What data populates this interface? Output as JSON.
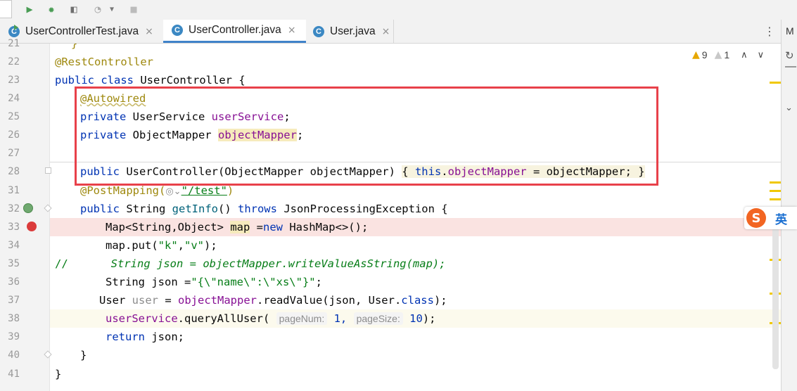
{
  "toolbar": {
    "buttons": [
      "run-icon",
      "debug-icon",
      "coverage-icon",
      "profiler-icon",
      "dropdown-icon",
      "stop-icon"
    ]
  },
  "tabs": [
    {
      "label": "UserControllerTest.java",
      "close": "×",
      "active": false
    },
    {
      "label": "UserController.java",
      "close": "×",
      "active": true
    },
    {
      "label": "User.java",
      "close": "×",
      "active": false
    }
  ],
  "tab_icon_letter": "C",
  "kebab": "⋮",
  "right_panel": {
    "label": "M"
  },
  "inspection": {
    "warnings": "9",
    "weak_warnings": "1"
  },
  "line_numbers": [
    "21",
    "22",
    "23",
    "24",
    "25",
    "26",
    "27",
    "28",
    "31",
    "32",
    "33",
    "34",
    "35",
    "36",
    "37",
    "38",
    "39",
    "40",
    "41"
  ],
  "code": {
    "l21": "}",
    "l22_annotation": "@RestController",
    "l23_public": "public",
    "l23_class": "class",
    "l23_rest": " UserController {",
    "l24_annotation": "@Autowired",
    "l25_private": "private",
    "l25_type": " UserService ",
    "l25_field": "userService",
    "l25_end": ";",
    "l26_private": "private",
    "l26_type": " ObjectMapper ",
    "l26_field": "objectMapper",
    "l26_end": ";",
    "l28_public": "public",
    "l28_sig": " UserController(ObjectMapper objectMapper) ",
    "l28_open": "{ ",
    "l28_this": "this",
    "l28_dot": ".",
    "l28_field": "objectMapper",
    "l28_assign": " = objectMapper; ",
    "l28_close": "}",
    "l31_annotation": "@PostMapping(",
    "l31_path": "\"/test\"",
    "l31_end": ")",
    "l32_public": "public",
    "l32_type": " String ",
    "l32_method": "getInfo",
    "l32_parens": "() ",
    "l32_throws": "throws",
    "l32_rest": " JsonProcessingException {",
    "l33_text1": "Map<String,Object> ",
    "l33_var": "map",
    "l33_eq": " =",
    "l33_new": "new",
    "l33_rest": " HashMap<>();",
    "l34_text1": "map.put(",
    "l34_k": "\"k\"",
    "l34_comma": ",",
    "l34_v": "\"v\"",
    "l34_end": ");",
    "l35_slashes": "//",
    "l35_comment": "String json = objectMapper.writeValueAsString(map);",
    "l36_text1": "String json =",
    "l36_str": "\"{\\\"name\\\":\\\"xs\\\"}\"",
    "l36_end": ";",
    "l37_type": "User ",
    "l37_var": "user",
    "l37_eq": " = ",
    "l37_field": "objectMapper",
    "l37_call": ".readValue(json, User.",
    "l37_class": "class",
    "l37_end": ");",
    "l38_field": "userService",
    "l38_call": ".queryAllUser( ",
    "l38_hint1": "pageNum:",
    "l38_val1": " 1, ",
    "l38_hint2": "pageSize:",
    "l38_val2": " 10",
    "l38_end": ");",
    "l39_return": "return",
    "l39_rest": " json;",
    "l40": "}",
    "l41": "}"
  },
  "ime": {
    "label": "英",
    "logo_letter": "S"
  },
  "colors": {
    "keyword": "#0033b3",
    "annotation": "#9e880d",
    "field": "#871094",
    "string": "#067d17",
    "highlight_box": "#e8414a",
    "breakpoint": "#db3b3b"
  }
}
